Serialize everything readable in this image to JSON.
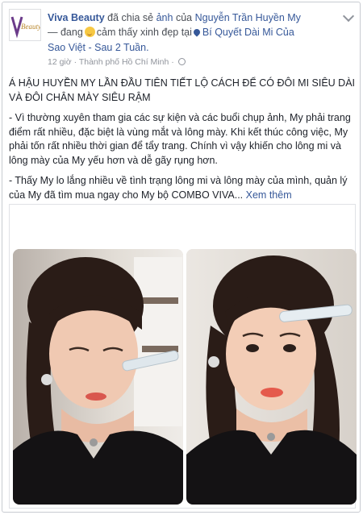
{
  "post": {
    "author": "Viva Beauty",
    "shared_text": "đã chia sẻ",
    "shared_object": "ảnh",
    "of_text": "của",
    "original_author": "Nguyễn Trần Huyền My",
    "line2_prefix": "— đang",
    "feeling_text": "cảm thấy xinh đẹp tại",
    "location": "Bí Quyết Dài Mi Của",
    "location_cont": "Sao Việt - Sau 2 Tuần.",
    "time": "12 giờ",
    "place": "Thành phố Hồ Chí Minh",
    "avatar_logo_text": "Viva Beauty",
    "icons": {
      "feeling": "smiling-face-icon",
      "location": "map-pin-icon",
      "privacy": "globe-icon",
      "menu": "chevron-down-icon"
    }
  },
  "content": {
    "headline": "Á HẬU HUYỀN MY LẦN ĐẦU TIÊN TIẾT LỘ CÁCH ĐỂ CÓ ĐÔI MI SIÊU DÀI VÀ ĐÔI CHÂN MÀY SIÊU RẬM",
    "paragraph1": "- Vì thường xuyên tham gia các sự kiện và các buổi chụp ảnh, My phải trang điểm rất nhiều, đặc biệt là vùng mắt và lông mày. Khi kết thúc công việc, My phải tốn rất nhiều thời gian để tẩy trang. Chính vì vậy khiến cho lông mi và lông mày của My yếu hơn và dễ gãy rụng hơn.",
    "paragraph2": "- Thấy My lo lắng nhiều về tình trạng lông mi và lông mày của mình, quản lý của My đã tìm mua ngay cho My bộ COMBO VIVA...",
    "see_more": "Xem thêm"
  },
  "colors": {
    "link": "#365899",
    "meta": "#90949c",
    "text": "#1d2129"
  }
}
